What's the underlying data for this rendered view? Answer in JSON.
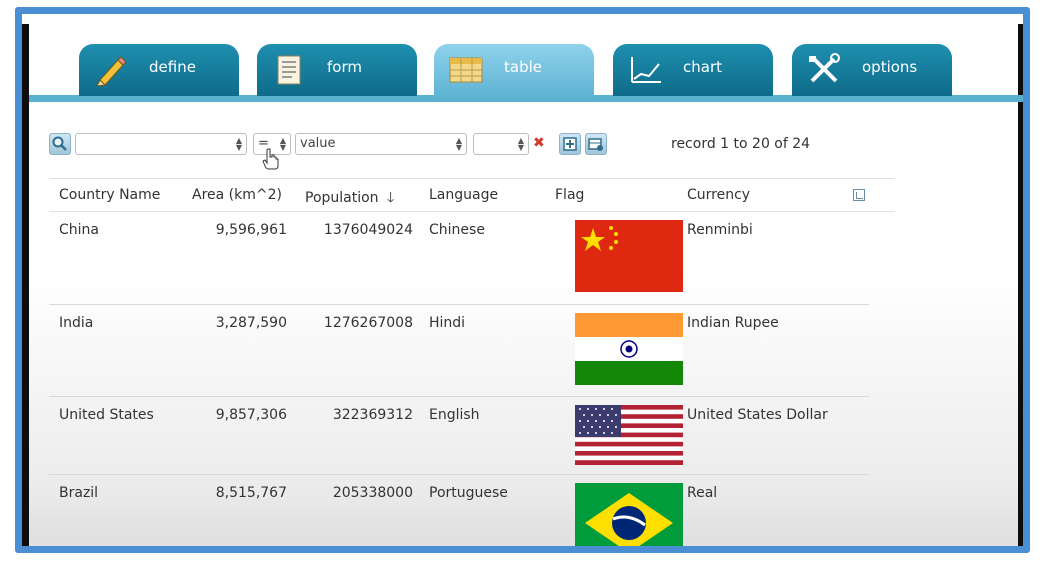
{
  "tabs": [
    {
      "label": "define",
      "icon": "pencil-icon"
    },
    {
      "label": "form",
      "icon": "form-icon"
    },
    {
      "label": "table",
      "icon": "table-icon",
      "active": true
    },
    {
      "label": "chart",
      "icon": "chart-icon"
    },
    {
      "label": "options",
      "icon": "tools-icon"
    }
  ],
  "toolbar": {
    "field_select": "",
    "operator_select": "=",
    "value_select": "value",
    "extra_select": "",
    "record_info": "record 1 to 20 of 24"
  },
  "table": {
    "headers": {
      "country": "Country Name",
      "area": "Area (km^2)",
      "population": "Population",
      "language": "Language",
      "flag": "Flag",
      "currency": "Currency"
    },
    "rows": [
      {
        "country": "China",
        "area": "9,596,961",
        "population": "1376049024",
        "language": "Chinese",
        "currency": "Renminbi",
        "flag": "china-flag"
      },
      {
        "country": "India",
        "area": "3,287,590",
        "population": "1276267008",
        "language": "Hindi",
        "currency": "Indian Rupee",
        "flag": "india-flag"
      },
      {
        "country": "United States",
        "area": "9,857,306",
        "population": "322369312",
        "language": "English",
        "currency": "United States Dollar",
        "flag": "usa-flag"
      },
      {
        "country": "Brazil",
        "area": "8,515,767",
        "population": "205338000",
        "language": "Portuguese",
        "currency": "Real",
        "flag": "brazil-flag"
      }
    ]
  },
  "colors": {
    "tab": "#1f8fb0",
    "tab_active": "#5ab0d1",
    "frame": "#4a8fd4"
  }
}
